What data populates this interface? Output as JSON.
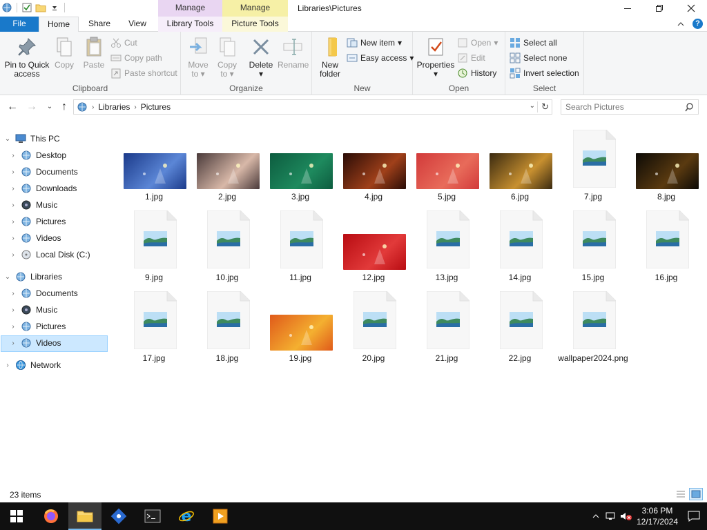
{
  "window": {
    "title": "Libraries\\Pictures",
    "context_groups": [
      "Manage",
      "Manage"
    ]
  },
  "tabs": {
    "file": "File",
    "home": "Home",
    "share": "Share",
    "view": "View",
    "library_tools": "Library Tools",
    "picture_tools": "Picture Tools"
  },
  "ribbon": {
    "clipboard": {
      "label": "Clipboard",
      "pin": "Pin to Quick access",
      "copy": "Copy",
      "paste": "Paste",
      "cut": "Cut",
      "copy_path": "Copy path",
      "paste_shortcut": "Paste shortcut"
    },
    "organize": {
      "label": "Organize",
      "move_to": "Move to",
      "copy_to": "Copy to",
      "delete": "Delete",
      "rename": "Rename"
    },
    "new": {
      "label": "New",
      "new_folder": "New folder",
      "new_item": "New item",
      "easy_access": "Easy access"
    },
    "open": {
      "label": "Open",
      "properties": "Properties",
      "open": "Open",
      "edit": "Edit",
      "history": "History"
    },
    "select": {
      "label": "Select",
      "select_all": "Select all",
      "select_none": "Select none",
      "invert": "Invert selection"
    }
  },
  "address": {
    "crumbs": [
      "Libraries",
      "Pictures"
    ],
    "search_placeholder": "Search Pictures"
  },
  "nav": {
    "this_pc": "This PC",
    "pc_items": [
      "Desktop",
      "Documents",
      "Downloads",
      "Music",
      "Pictures",
      "Videos",
      "Local Disk (C:)"
    ],
    "libraries": "Libraries",
    "lib_items": [
      "Documents",
      "Music",
      "Pictures",
      "Videos"
    ],
    "network": "Network",
    "selected": "Videos"
  },
  "files": [
    {
      "name": "1.jpg",
      "kind": "photo",
      "colors": [
        "#1b3a8a",
        "#5b86d6"
      ]
    },
    {
      "name": "2.jpg",
      "kind": "photo",
      "colors": [
        "#4a3a3a",
        "#d8b8a8"
      ]
    },
    {
      "name": "3.jpg",
      "kind": "photo",
      "colors": [
        "#0d5c3f",
        "#1e8a5e"
      ]
    },
    {
      "name": "4.jpg",
      "kind": "photo",
      "colors": [
        "#2a0c06",
        "#a0401a"
      ]
    },
    {
      "name": "5.jpg",
      "kind": "photo",
      "colors": [
        "#d23a3a",
        "#e86b5a"
      ]
    },
    {
      "name": "6.jpg",
      "kind": "photo",
      "colors": [
        "#3a2a10",
        "#c89030"
      ]
    },
    {
      "name": "7.jpg",
      "kind": "doc"
    },
    {
      "name": "8.jpg",
      "kind": "photo",
      "colors": [
        "#0c0a06",
        "#5a3a10"
      ]
    },
    {
      "name": "9.jpg",
      "kind": "doc"
    },
    {
      "name": "10.jpg",
      "kind": "doc"
    },
    {
      "name": "11.jpg",
      "kind": "doc"
    },
    {
      "name": "12.jpg",
      "kind": "photo",
      "colors": [
        "#b80c12",
        "#e23a3a"
      ]
    },
    {
      "name": "13.jpg",
      "kind": "doc"
    },
    {
      "name": "14.jpg",
      "kind": "doc"
    },
    {
      "name": "15.jpg",
      "kind": "doc"
    },
    {
      "name": "16.jpg",
      "kind": "doc"
    },
    {
      "name": "17.jpg",
      "kind": "doc"
    },
    {
      "name": "18.jpg",
      "kind": "doc"
    },
    {
      "name": "19.jpg",
      "kind": "photo",
      "colors": [
        "#e05a1a",
        "#f4b030"
      ]
    },
    {
      "name": "20.jpg",
      "kind": "doc"
    },
    {
      "name": "21.jpg",
      "kind": "doc"
    },
    {
      "name": "22.jpg",
      "kind": "doc"
    },
    {
      "name": "wallpaper2024.png",
      "kind": "doc"
    }
  ],
  "status": {
    "count": "23 items"
  },
  "taskbar": {
    "time": "3:06 PM",
    "date": "12/17/2024"
  }
}
